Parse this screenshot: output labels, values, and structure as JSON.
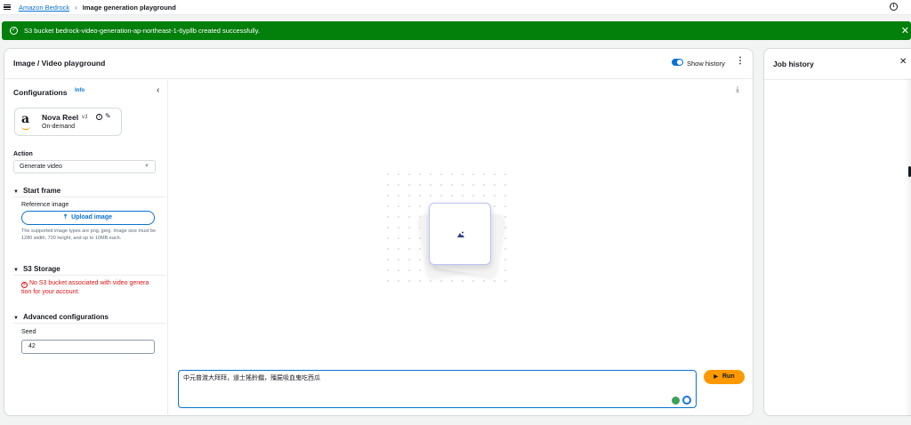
{
  "topbar": {
    "breadcrumb_link": "Amazon Bedrock",
    "breadcrumb_sep": "›",
    "breadcrumb_current": "Image generation playground",
    "info_icon": "i"
  },
  "flash": {
    "message": "S3 bucket bedrock-video-generation-ap-northeast-1-6ypllb created successfully.",
    "check_icon": "✓",
    "close_icon": "✕"
  },
  "playground": {
    "title": "Image / Video playground",
    "show_history_label": "Show history",
    "show_history_on": true,
    "kebab": "⋮"
  },
  "config": {
    "title": "Configurations",
    "info": "Info",
    "collapse": "‹",
    "model": {
      "logo": "a",
      "name": "Nova Reel",
      "version": "v1",
      "info_glyph": "i",
      "edit_glyph": "✎",
      "mode": "On-demand"
    },
    "action_label": "Action",
    "action_value": "Generate video",
    "select_arrow": "▼",
    "start_frame": {
      "title": "Start frame",
      "reference_label": "Reference image",
      "upload_label": "Upload image",
      "upload_glyph": "⤒",
      "help": "The supported image types are png, jpeg. Image size must be 1280 width, 720 height, and up to 10MB each."
    },
    "s3_storage": {
      "title": "S3 Storage",
      "error_glyph": "✕",
      "error": "No S3 bucket associated with video genera tion for your account."
    },
    "advanced": {
      "title": "Advanced configurations",
      "seed_label": "Seed",
      "seed_value": "42"
    },
    "section_toggle": "▼"
  },
  "canvas": {
    "download_glyph": "⤓",
    "prompt_text": "中元普渡大拜拜，道士搖鈴鐺，殭屍吸血鬼吃西瓜",
    "run_label": "Run",
    "run_glyph": "▶"
  },
  "job_history": {
    "title": "Job history",
    "close": "✕"
  },
  "colors": {
    "accent": "#0972d3",
    "success": "#037f0c",
    "error": "#d91515",
    "run": "#ff9900"
  }
}
